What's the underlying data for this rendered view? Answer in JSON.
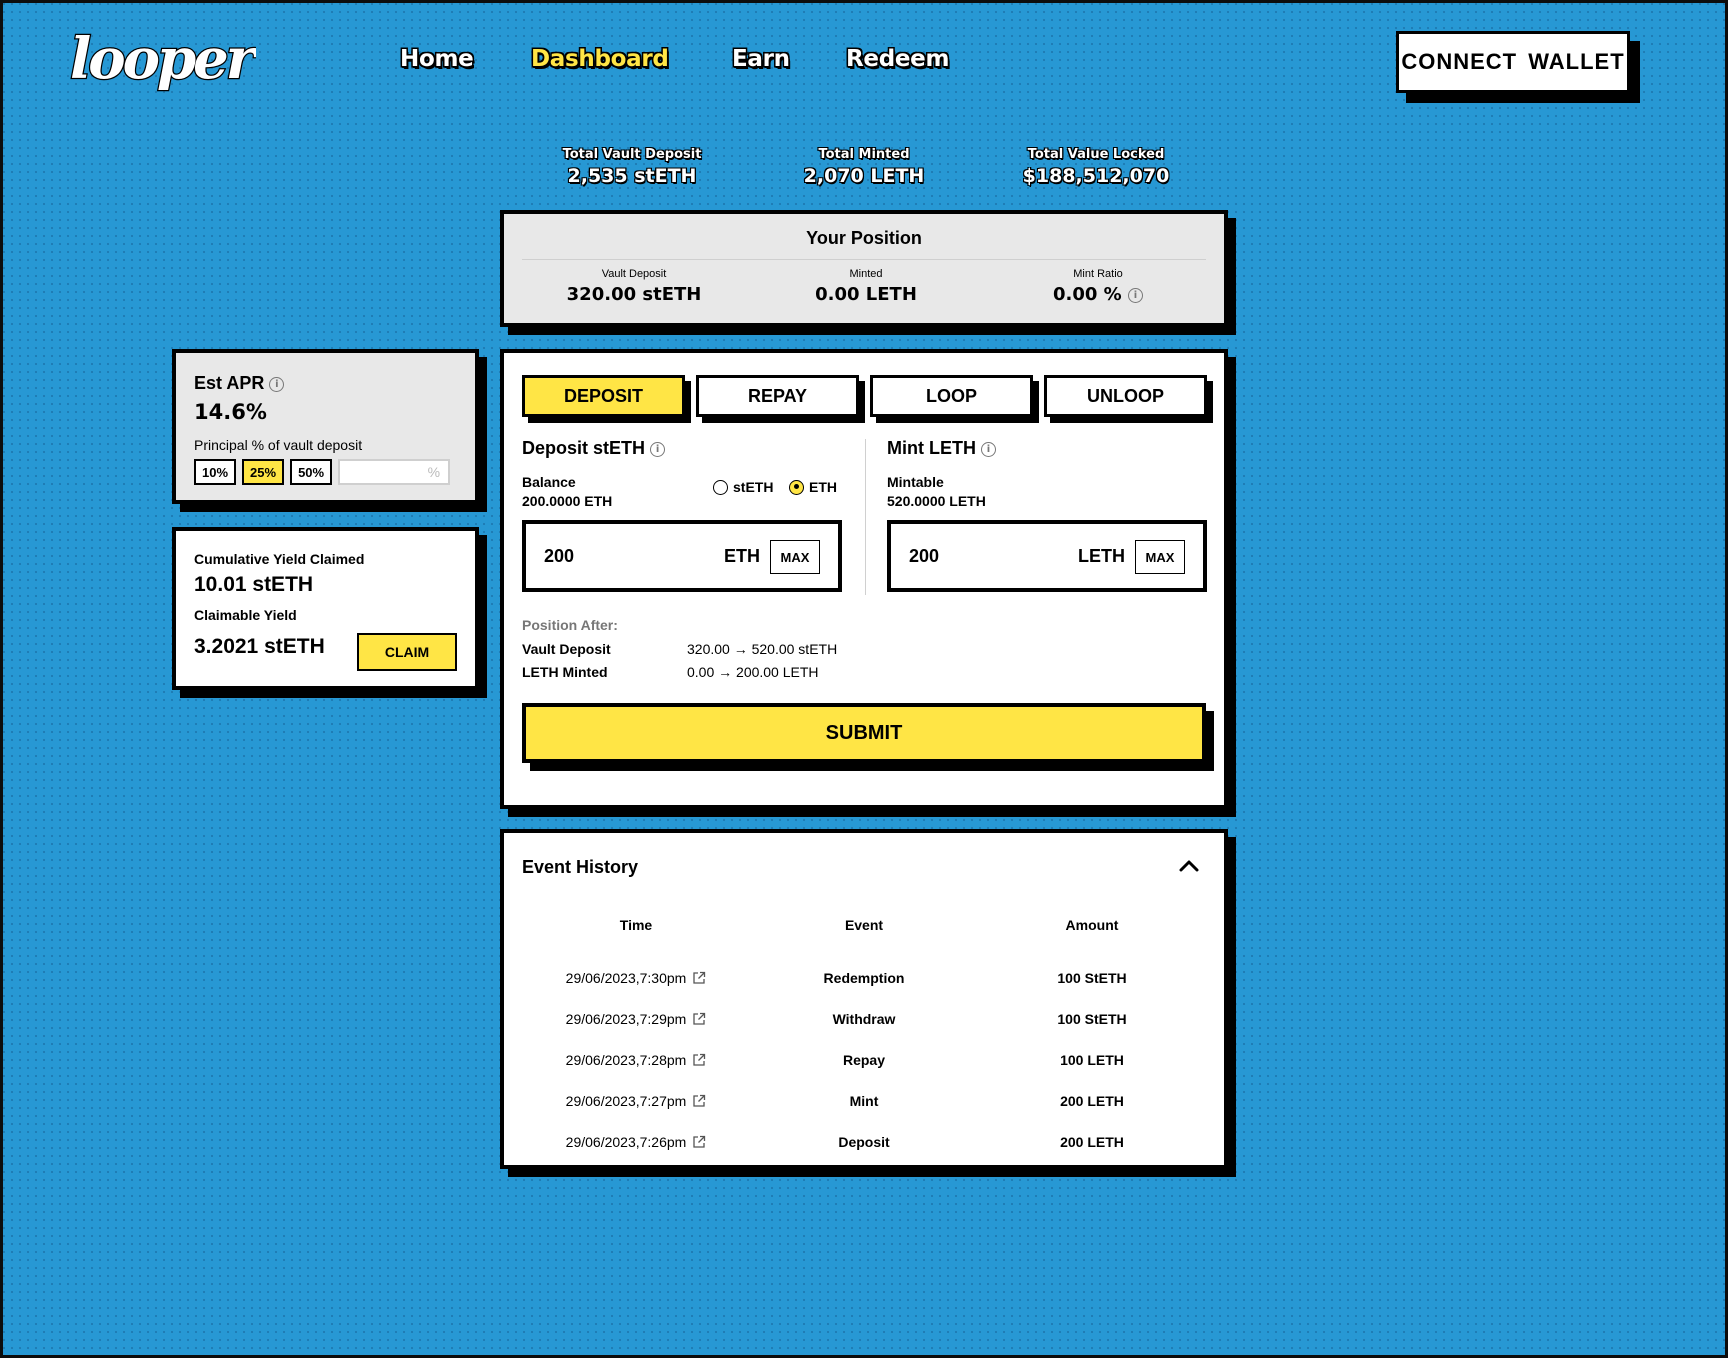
{
  "brand": {
    "logo_text": "looper"
  },
  "nav": {
    "items": [
      {
        "label": "Home"
      },
      {
        "label": "Dashboard",
        "active": true
      },
      {
        "label": "Earn"
      },
      {
        "label": "Redeem"
      }
    ],
    "connect_label": "CONNECT  WALLET"
  },
  "stats": {
    "vault_deposit": {
      "label": "Total Vault Deposit",
      "value": "2,535 stETH"
    },
    "minted": {
      "label": "Total Minted",
      "value": "2,070 LETH"
    },
    "tvl": {
      "label": "Total Value Locked",
      "value": "$188,512,070"
    }
  },
  "position": {
    "title": "Your Position",
    "vault_deposit": {
      "label": "Vault Deposit",
      "value": "320.00 stETH"
    },
    "minted": {
      "label": "Minted",
      "value": "0.00 LETH"
    },
    "mint_ratio": {
      "label": "Mint Ratio",
      "value": "0.00 %"
    }
  },
  "apr": {
    "title": "Est APR",
    "value": "14.6%",
    "subtitle": "Principal % of vault deposit",
    "options": [
      "10%",
      "25%",
      "50%"
    ],
    "selected": "25%",
    "custom_suffix": "%"
  },
  "yield": {
    "cumulative_label": "Cumulative Yield Claimed",
    "cumulative_value": "10.01 stETH",
    "claimable_label": "Claimable Yield",
    "claimable_value": "3.2021 stETH",
    "claim_label": "CLAIM"
  },
  "tabs": [
    {
      "label": "DEPOSIT",
      "active": true
    },
    {
      "label": "REPAY"
    },
    {
      "label": "LOOP"
    },
    {
      "label": "UNLOOP"
    }
  ],
  "deposit": {
    "title": "Deposit stETH",
    "balance_label": "Balance",
    "balance_value": "200.0000 ETH",
    "radio_options": [
      "stETH",
      "ETH"
    ],
    "radio_selected": "ETH",
    "amount": "200",
    "unit": "ETH",
    "max_label": "MAX"
  },
  "mint": {
    "title": "Mint LETH",
    "mintable_label": "Mintable",
    "mintable_value": "520.0000 LETH",
    "amount": "200",
    "unit": "LETH",
    "max_label": "MAX"
  },
  "position_after": {
    "title": "Position After:",
    "rows": [
      {
        "label": "Vault Deposit",
        "value": "320.00 → 520.00 stETH"
      },
      {
        "label": "LETH Minted",
        "value": "0.00 → 200.00 LETH"
      }
    ]
  },
  "submit_label": "SUBMIT",
  "events": {
    "title": "Event History",
    "columns": [
      "Time",
      "Event",
      "Amount"
    ],
    "rows": [
      {
        "time": "29/06/2023,7:30pm",
        "event": "Redemption",
        "amount": "100 StETH"
      },
      {
        "time": "29/06/2023,7:29pm",
        "event": "Withdraw",
        "amount": "100 StETH"
      },
      {
        "time": "29/06/2023,7:28pm",
        "event": "Repay",
        "amount": "100 LETH"
      },
      {
        "time": "29/06/2023,7:27pm",
        "event": "Mint",
        "amount": "200 LETH"
      },
      {
        "time": "29/06/2023,7:26pm",
        "event": "Deposit",
        "amount": "200 LETH"
      }
    ]
  },
  "colors": {
    "background": "#2798d4",
    "accent": "#ffe545",
    "ink": "#000000",
    "panel_grey": "#e8e8e8"
  }
}
